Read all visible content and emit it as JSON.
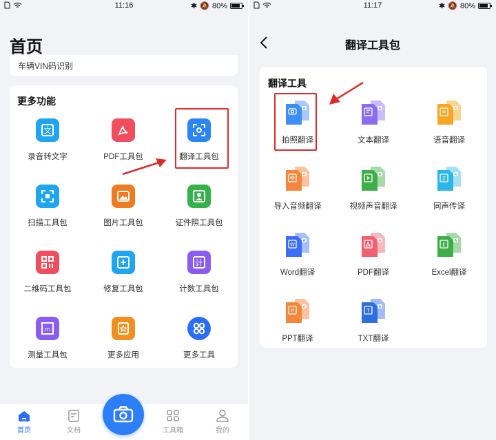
{
  "left": {
    "status": {
      "time": "11:16",
      "battery": "80%"
    },
    "page_title": "首页",
    "top_item": "车辆VIN码识别",
    "section_title": "更多功能",
    "tools": [
      {
        "label": "录音转文字",
        "icon": "doc-text-icon",
        "color": "#1fa6f0"
      },
      {
        "label": "PDF工具包",
        "icon": "pdf-icon",
        "color": "#f04d5e"
      },
      {
        "label": "翻译工具包",
        "icon": "translate-scan-icon",
        "color": "#2a86f5"
      },
      {
        "label": "扫描工具包",
        "icon": "scan-icon",
        "color": "#1fa6f0"
      },
      {
        "label": "图片工具包",
        "icon": "image-icon",
        "color": "#f07a1f"
      },
      {
        "label": "证件照工具包",
        "icon": "id-photo-icon",
        "color": "#35b34a"
      },
      {
        "label": "二维码工具包",
        "icon": "qrcode-icon",
        "color": "#f04d5e"
      },
      {
        "label": "修复工具包",
        "icon": "repair-icon",
        "color": "#1fa6f0"
      },
      {
        "label": "计数工具包",
        "icon": "counter-icon",
        "color": "#8a5cf0"
      },
      {
        "label": "测量工具包",
        "icon": "measure-icon",
        "color": "#8a5cf0"
      },
      {
        "label": "更多应用",
        "icon": "star-icon",
        "color": "#f0901f"
      },
      {
        "label": "更多工具",
        "icon": "grid-icon",
        "color": "#2a6ef5"
      }
    ],
    "tabs": [
      {
        "label": "首页",
        "icon": "home-icon"
      },
      {
        "label": "文档",
        "icon": "document-icon"
      },
      {
        "label": "工具箱",
        "icon": "toolbox-icon"
      },
      {
        "label": "我的",
        "icon": "user-icon"
      }
    ]
  },
  "right": {
    "status": {
      "time": "11:17",
      "battery": "80%"
    },
    "title": "翻译工具包",
    "section_title": "翻译工具",
    "tools": [
      {
        "label": "拍照翻译",
        "icon": "camera-translate-icon",
        "color": "#3d8ef7",
        "back": "#a9c8fb"
      },
      {
        "label": "文本翻译",
        "icon": "text-translate-icon",
        "color": "#8b6cf0",
        "back": "#c9bcf8"
      },
      {
        "label": "语音翻译",
        "icon": "voice-translate-icon",
        "color": "#f5a623",
        "back": "#fbd48f"
      },
      {
        "label": "导入音频翻译",
        "icon": "audio-translate-icon",
        "color": "#f5873d",
        "back": "#fbc29b"
      },
      {
        "label": "视频声音翻译",
        "icon": "video-translate-icon",
        "color": "#3fae49",
        "back": "#a6dba9"
      },
      {
        "label": "同声传译",
        "icon": "simultaneous-icon",
        "color": "#2bb8e6",
        "back": "#a5e0f4"
      },
      {
        "label": "Word翻译",
        "icon": "word-translate-icon",
        "color": "#3d6ef7",
        "back": "#a8bffb"
      },
      {
        "label": "PDF翻译",
        "icon": "pdf-translate-icon",
        "color": "#f0616f",
        "back": "#f8b6bd"
      },
      {
        "label": "Excel翻译",
        "icon": "excel-translate-icon",
        "color": "#3fae49",
        "back": "#a6dba9"
      },
      {
        "label": "PPT翻译",
        "icon": "ppt-translate-icon",
        "color": "#f5873d",
        "back": "#fbc29b"
      },
      {
        "label": "TXT翻译",
        "icon": "txt-translate-icon",
        "color": "#2f6ee0",
        "back": "#a3bdf2"
      }
    ]
  }
}
